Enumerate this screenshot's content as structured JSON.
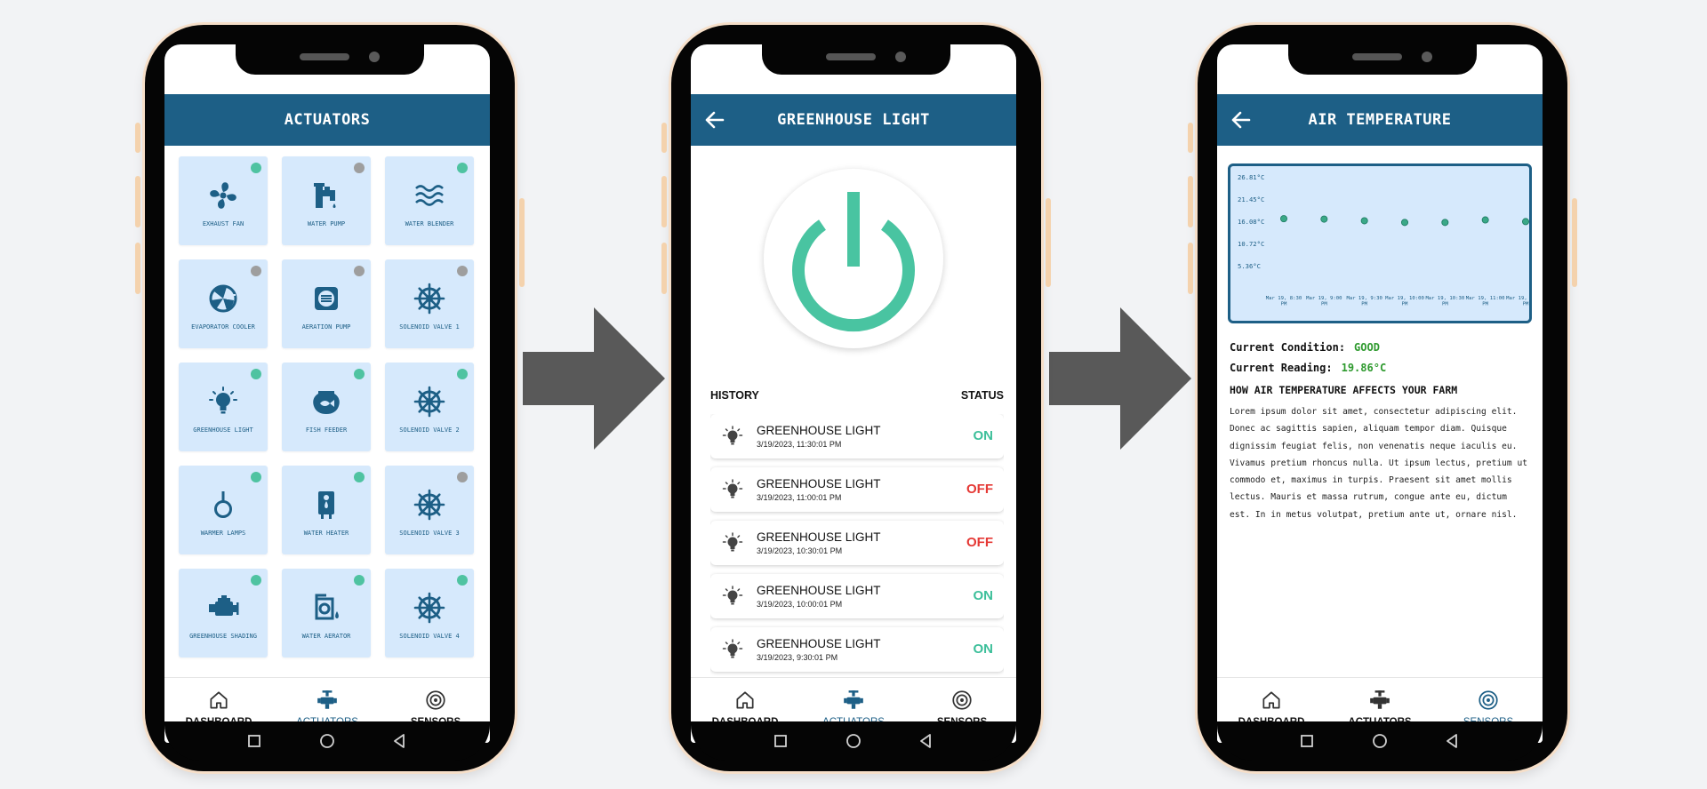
{
  "colors": {
    "header": "#1d5f86",
    "tile_bg": "#d6e9fc",
    "status_on": "#4fc3a1",
    "status_off": "#9e9e9e",
    "text_on": "#3cbf9a",
    "text_off": "#e53935",
    "good": "#2e9a2e",
    "arrow": "#595959",
    "power": "#49c4a1"
  },
  "nav": {
    "dashboard": "DASHBOARD",
    "actuators": "ACTUATORS",
    "sensors": "SENSORS"
  },
  "screen1": {
    "title": "ACTUATORS",
    "tiles": [
      {
        "label": "EXHAUST FAN",
        "icon": "fan-icon",
        "status": "on"
      },
      {
        "label": "WATER PUMP",
        "icon": "faucet-icon",
        "status": "off"
      },
      {
        "label": "WATER BLENDER",
        "icon": "water-waves-icon",
        "status": "on"
      },
      {
        "label": "EVAPORATOR COOLER",
        "icon": "cooler-fan-icon",
        "status": "off"
      },
      {
        "label": "AERATION PUMP",
        "icon": "air-vent-icon",
        "status": "off"
      },
      {
        "label": "SOLENOID VALVE 1",
        "icon": "valve-wheel-icon",
        "status": "off"
      },
      {
        "label": "GREENHOUSE LIGHT",
        "icon": "light-bulb-icon",
        "status": "on"
      },
      {
        "label": "FISH FEEDER",
        "icon": "fish-bowl-icon",
        "status": "on"
      },
      {
        "label": "SOLENOID VALVE 2",
        "icon": "valve-wheel-icon",
        "status": "on"
      },
      {
        "label": "WARMER LAMPS",
        "icon": "hanging-lamp-icon",
        "status": "on"
      },
      {
        "label": "WATER HEATER",
        "icon": "water-heater-icon",
        "status": "on"
      },
      {
        "label": "SOLENOID VALVE 3",
        "icon": "valve-wheel-icon",
        "status": "off"
      },
      {
        "label": "GREENHOUSE SHADING",
        "icon": "engine-icon",
        "status": "on"
      },
      {
        "label": "WATER AERATOR",
        "icon": "aerator-icon",
        "status": "on"
      },
      {
        "label": "SOLENOID VALVE 4",
        "icon": "valve-wheel-icon",
        "status": "on"
      }
    ]
  },
  "screen2": {
    "title": "GREENHOUSE LIGHT",
    "history_label": "HISTORY",
    "status_label": "STATUS",
    "history": [
      {
        "name": "GREENHOUSE LIGHT",
        "time": "3/19/2023, 11:30:01 PM",
        "status": "ON"
      },
      {
        "name": "GREENHOUSE LIGHT",
        "time": "3/19/2023, 11:00:01 PM",
        "status": "OFF"
      },
      {
        "name": "GREENHOUSE LIGHT",
        "time": "3/19/2023, 10:30:01 PM",
        "status": "OFF"
      },
      {
        "name": "GREENHOUSE LIGHT",
        "time": "3/19/2023, 10:00:01 PM",
        "status": "ON"
      },
      {
        "name": "GREENHOUSE LIGHT",
        "time": "3/19/2023, 9:30:01 PM",
        "status": "ON"
      }
    ]
  },
  "screen3": {
    "title": "AIR TEMPERATURE",
    "condition_label": "Current Condition:",
    "condition_value": "GOOD",
    "reading_label": "Current Reading:",
    "reading_value": "19.86°C",
    "affects_title": "HOW AIR TEMPERATURE AFFECTS YOUR FARM",
    "body": "Lorem ipsum dolor sit amet, consectetur adipiscing elit. Donec ac sagittis sapien, aliquam tempor diam. Quisque dignissim feugiat felis, non venenatis neque iaculis eu. Vivamus pretium rhoncus nulla. Ut ipsum lectus, pretium ut commodo et, maximus in turpis. Praesent sit amet mollis lectus. Mauris et massa rutrum, congue ante eu, dictum est. In in metus volutpat, pretium ante ut, ornare nisl."
  },
  "chart_data": {
    "type": "scatter",
    "y_ticks": [
      "26.81°C",
      "21.45°C",
      "16.08°C",
      "10.72°C",
      "5.36°C"
    ],
    "ylim": [
      0,
      26.81
    ],
    "x": [
      "Mar 19, 8:30 PM",
      "Mar 19, 9:00 PM",
      "Mar 19, 9:30 PM",
      "Mar 19, 10:00 PM",
      "Mar 19, 10:30 PM",
      "Mar 19, 11:00 PM",
      "Mar 19, 11:30 PM"
    ],
    "values": [
      16.7,
      16.6,
      16.2,
      15.8,
      15.8,
      16.4,
      16.0
    ]
  }
}
